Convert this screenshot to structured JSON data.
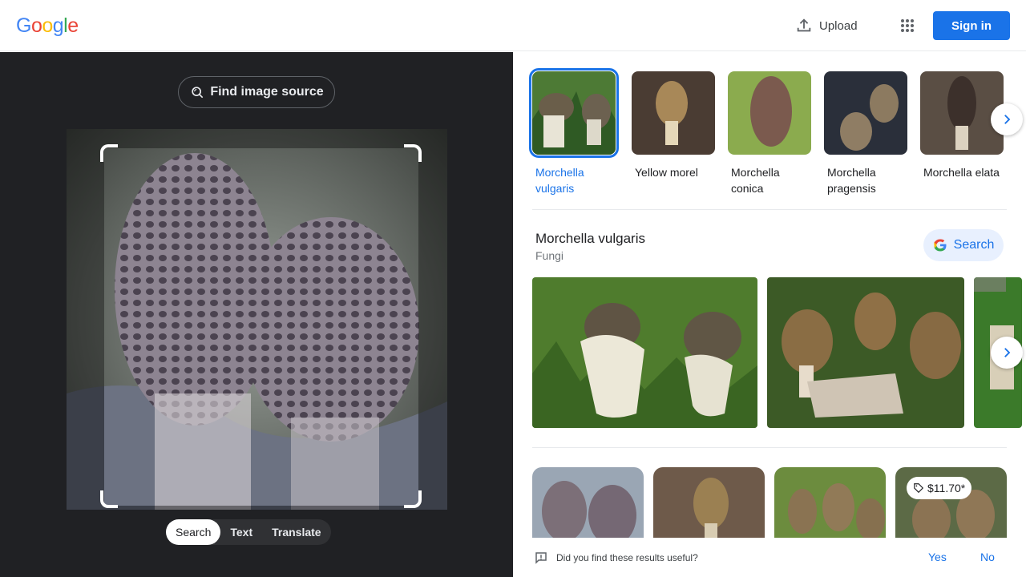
{
  "header": {
    "logo": [
      "G",
      "o",
      "o",
      "g",
      "l",
      "e"
    ],
    "logo_colors": [
      "#4285f4",
      "#ea4335",
      "#fbbc05",
      "#4285f4",
      "#34a853",
      "#ea4335"
    ],
    "upload_label": "Upload",
    "signin_label": "Sign in"
  },
  "left": {
    "find_source_label": "Find image source",
    "modes": [
      "Search",
      "Text",
      "Translate"
    ],
    "active_mode": "Search"
  },
  "right": {
    "entities": [
      {
        "label": "Morchella vulgaris",
        "selected": true
      },
      {
        "label": "Yellow morel",
        "selected": false
      },
      {
        "label": "Morchella conica",
        "selected": false
      },
      {
        "label": "Morchella pragensis",
        "selected": false
      },
      {
        "label": "Morchella elata",
        "selected": false
      }
    ],
    "knowledge": {
      "title": "Morchella vulgaris",
      "subtitle": "Fungi",
      "search_label": "Search"
    },
    "price_badge": "$11.70*"
  },
  "feedback": {
    "question": "Did you find these results useful?",
    "yes": "Yes",
    "no": "No"
  },
  "colors": {
    "accent": "#1a73e8",
    "dark_bg": "#202124"
  }
}
